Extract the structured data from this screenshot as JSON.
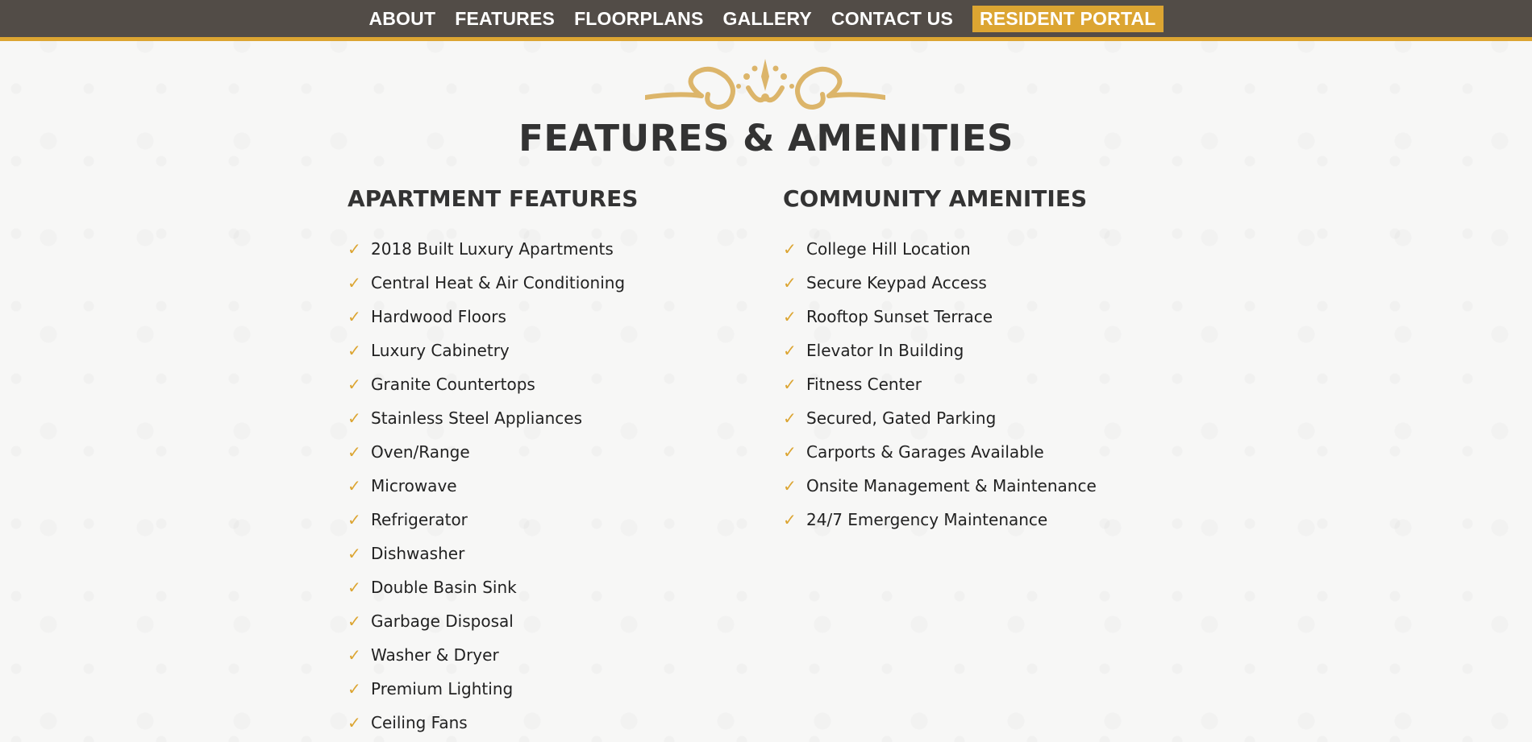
{
  "nav": {
    "items": [
      "ABOUT",
      "FEATURES",
      "FLOORPLANS",
      "GALLERY",
      "CONTACT US"
    ],
    "portal_label": "RESIDENT PORTAL"
  },
  "colors": {
    "nav_bg": "#524c47",
    "accent": "#dca532",
    "heading": "#333333"
  },
  "page": {
    "title": "FEATURES & AMENITIES",
    "ornament_icon": "decorative-scroll-ornament"
  },
  "apartment": {
    "title": "APARTMENT FEATURES",
    "items": [
      "2018 Built Luxury Apartments",
      "Central Heat & Air Conditioning",
      "Hardwood Floors",
      "Luxury Cabinetry",
      "Granite Countertops",
      "Stainless Steel Appliances",
      "Oven/Range",
      "Microwave",
      "Refrigerator",
      "Dishwasher",
      "Double Basin Sink",
      "Garbage Disposal",
      "Washer & Dryer",
      "Premium Lighting",
      "Ceiling Fans"
    ]
  },
  "community": {
    "title": "COMMUNITY AMENITIES",
    "items": [
      "College Hill Location",
      "Secure Keypad Access",
      "Rooftop Sunset Terrace",
      "Elevator In Building",
      "Fitness Center",
      "Secured, Gated Parking",
      "Carports & Garages Available",
      "Onsite Management & Maintenance",
      "24/7 Emergency Maintenance"
    ]
  },
  "check_glyph": "✓"
}
